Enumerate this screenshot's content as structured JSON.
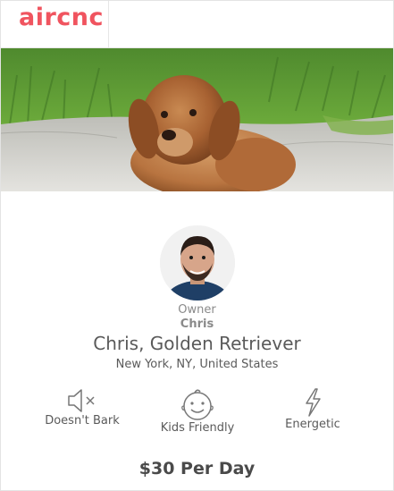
{
  "header": {
    "logo_text": "aircnc"
  },
  "colors": {
    "brand": "#f0545f",
    "text": "#5a5a5a",
    "muted": "#8a8a8a",
    "border": "#e6e6e6"
  },
  "owner": {
    "label": "Owner",
    "name": "Chris"
  },
  "listing": {
    "title": "Chris, Golden Retriever",
    "location": "New York, NY, United States",
    "price": "$30 Per Day"
  },
  "traits": [
    {
      "icon": "muted-speaker-icon",
      "label": "Doesn't Bark"
    },
    {
      "icon": "baby-face-icon",
      "label": "Kids Friendly"
    },
    {
      "icon": "lightning-icon",
      "label": "Energetic"
    }
  ]
}
